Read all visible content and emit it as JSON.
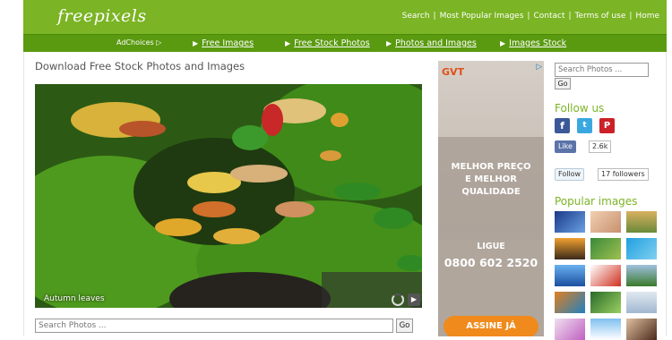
{
  "header": {
    "logo": "freepixels",
    "links": [
      "Search",
      "Most Popular Images",
      "Contact",
      "Terms of use",
      "Home"
    ]
  },
  "nav": {
    "adchoices": "AdChoices",
    "adchoices_icon": "adchoices-icon",
    "items": [
      "Free Images",
      "Free Stock Photos",
      "Photos and Images",
      "Images Stock"
    ]
  },
  "main": {
    "title": "Download Free Stock Photos and Images",
    "photo_caption": "Autumn leaves",
    "search_placeholder": "Search Photos ...",
    "go_label": "Go"
  },
  "ad": {
    "brand": "GVT",
    "headline_line1": "MELHOR PREÇO",
    "headline_line2": "E MELHOR",
    "headline_line3": "QUALIDADE",
    "ligue": "LIGUE",
    "phone": "0800 602 2520",
    "cta": "ASSINE JÁ"
  },
  "sidebar": {
    "search_placeholder": "Search Photos ...",
    "go_label": "Go",
    "follow_title": "Follow us",
    "fb_like": "Like",
    "fb_count": "2.6k",
    "tw_follow": "Follow",
    "tw_followers": "17 followers",
    "popular_title": "Popular images"
  },
  "colors": {
    "brand_green": "#7bb424",
    "nav_green": "#5a9a10",
    "ad_orange": "#f08a1c"
  }
}
